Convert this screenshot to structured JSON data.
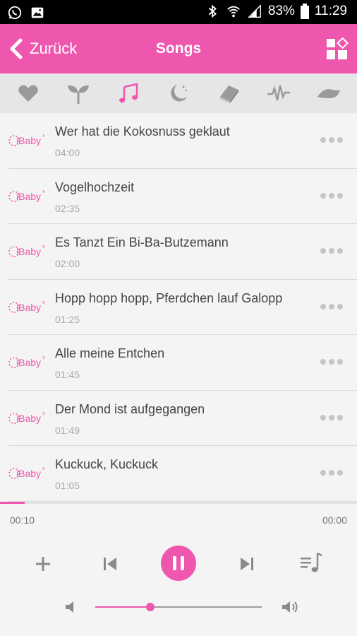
{
  "status_bar": {
    "battery": "83%",
    "time": "11:29"
  },
  "header": {
    "back_label": "Zurück",
    "title": "Songs"
  },
  "tabs": [
    {
      "icon": "heart-icon",
      "active": false
    },
    {
      "icon": "sprout-icon",
      "active": false
    },
    {
      "icon": "music-note-icon",
      "active": true
    },
    {
      "icon": "moon-stars-icon",
      "active": false
    },
    {
      "icon": "book-icon",
      "active": false
    },
    {
      "icon": "heartbeat-icon",
      "active": false
    },
    {
      "icon": "wave-icon",
      "active": false
    }
  ],
  "songs": [
    {
      "logo": "iBaby",
      "title": "Wer hat die Kokosnuss geklaut",
      "duration": "04:00"
    },
    {
      "logo": "iBaby",
      "title": "Vogelhochzeit",
      "duration": "02:35"
    },
    {
      "logo": "iBaby",
      "title": "Es Tanzt Ein Bi-Ba-Butzemann",
      "duration": "02:00"
    },
    {
      "logo": "iBaby",
      "title": "Hopp hopp hopp, Pferdchen lauf Galopp",
      "duration": "01:25"
    },
    {
      "logo": "iBaby",
      "title": "Alle meine Entchen",
      "duration": "01:45"
    },
    {
      "logo": "iBaby",
      "title": "Der Mond ist aufgegangen",
      "duration": "01:49"
    },
    {
      "logo": "iBaby",
      "title": "Kuckuck, Kuckuck",
      "duration": "01:05"
    }
  ],
  "player": {
    "current_time": "00:10",
    "total_time": "00:00",
    "progress": 0.07,
    "volume": 0.33,
    "state": "playing"
  },
  "colors": {
    "accent": "#ef57ae",
    "inactive_icon": "#9a9a9a"
  }
}
